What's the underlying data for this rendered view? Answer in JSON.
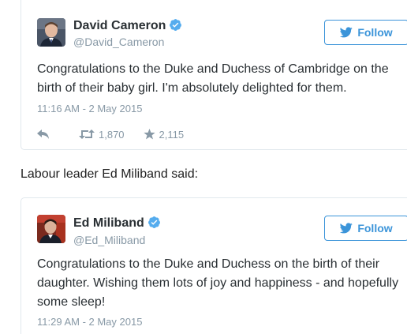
{
  "colors": {
    "accent": "#3b94d9",
    "verified": "#55acee",
    "muted": "#8899a6",
    "text": "#292f33",
    "border": "#e1e8ed"
  },
  "tweets": [
    {
      "display_name": "David Cameron",
      "handle": "@David_Cameron",
      "verified_icon": "verified-badge-icon",
      "follow_label": "Follow",
      "text": "Congratulations to the Duke and Duchess of Cambridge on the birth of their baby girl. I'm absolutely delighted for them.",
      "timestamp": "11:16 AM - 2 May 2015",
      "actions": {
        "reply_icon": "reply-icon",
        "retweet_icon": "retweet-icon",
        "retweet_count": "1,870",
        "favorite_icon": "star-icon",
        "favorite_count": "2,115"
      }
    },
    {
      "display_name": "Ed Miliband",
      "handle": "@Ed_Miliband",
      "verified_icon": "verified-badge-icon",
      "follow_label": "Follow",
      "text": "Congratulations to the Duke and Duchess on the birth of their daughter. Wishing them lots of joy and happiness - and hopefully some sleep!",
      "timestamp": "11:29 AM - 2 May 2015"
    }
  ],
  "caption": "Labour leader Ed Miliband said:"
}
